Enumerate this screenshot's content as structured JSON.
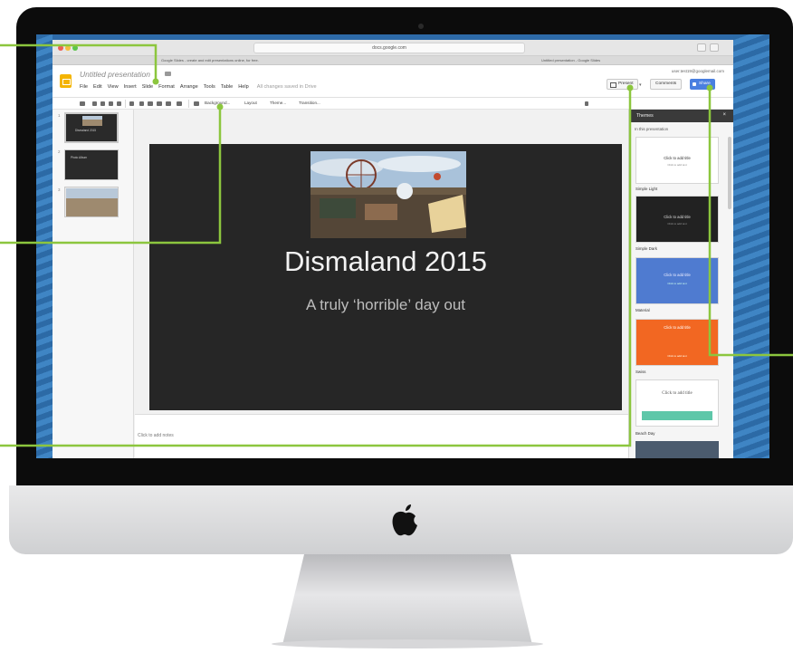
{
  "browser": {
    "url": "docs.google.com",
    "tab_left": "Google Slides - create and edit presentations online, for free.",
    "tab_right": "Untitled presentation - Google Slides"
  },
  "app": {
    "doc_title": "Untitled presentation",
    "user_email": "user.test19@googlemail.com",
    "menu": [
      "File",
      "Edit",
      "View",
      "Insert",
      "Slide",
      "Format",
      "Arrange",
      "Tools",
      "Table",
      "Help"
    ],
    "saved_status": "All changes saved in Drive",
    "present_label": "Present",
    "comments_label": "Comments",
    "share_label": "Share"
  },
  "toolbar": {
    "background": "Background...",
    "layout": "Layout",
    "theme": "Theme...",
    "transition": "Transition..."
  },
  "filmstrip": {
    "numbers": [
      "1",
      "2",
      "3"
    ],
    "slide1_title": "Dismaland 2015",
    "slide2_title": "Photo Album"
  },
  "slide": {
    "title": "Dismaland 2015",
    "subtitle": "A truly ‘horrible’ day out"
  },
  "notes": {
    "placeholder": "Click to add notes"
  },
  "themes": {
    "title": "Themes",
    "close": "×",
    "section": "In this presentation",
    "card_title": "Click to add title",
    "card_text": "Click to add text",
    "names": [
      "Simple Light",
      "Simple Dark",
      "Material",
      "Swiss",
      "Beach Day"
    ]
  },
  "colors": {
    "callout": "#8cc63e",
    "slide_bg": "#262626",
    "share_blue": "#4a7fe0",
    "material_orange": "#f26722",
    "streamline_blue": "#4f7bd0"
  }
}
